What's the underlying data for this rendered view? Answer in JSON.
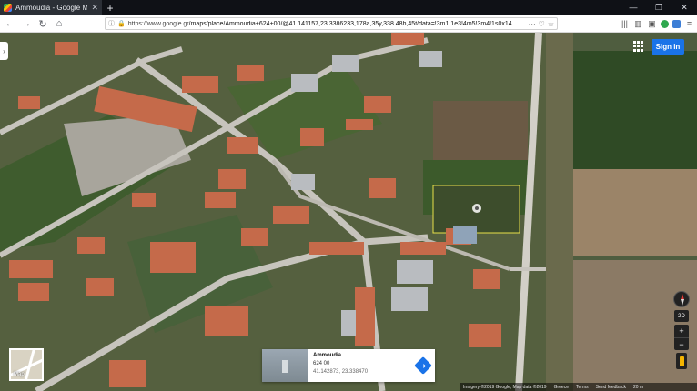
{
  "browser": {
    "tab_title": "Ammoudia - Google Maps",
    "new_tab_label": "+",
    "url_host": "https://www.google.gr",
    "url_path": "/maps/place/Ammoudia+624+00/@41.141157,23.3386233,178a,35y,338.48h,45t/data=!3m1!1e3!4m5!3m4!1s0x14",
    "window_controls": {
      "minimize": "—",
      "maximize": "❐",
      "close": "✕"
    }
  },
  "maps": {
    "signin_label": "Sign in",
    "minimap_label": "Map",
    "place_card": {
      "name": "Ammoudia",
      "postal": "624 00",
      "coords": "41.142873, 23.338470"
    },
    "controls": {
      "view_label": "2D",
      "zoom_in": "+",
      "zoom_out": "−"
    },
    "footer": {
      "imagery": "Imagery ©2019 Google, Map data ©2019",
      "country": "Greece",
      "terms": "Terms",
      "feedback": "Send feedback",
      "scale": "20 m"
    }
  },
  "colors": {
    "tabbar": "#0f1116",
    "signin": "#1a73e8",
    "roof": "#c56a4a",
    "field": "#6b5b45",
    "grass": "#3f5c2e",
    "road": "#bfbfbf"
  }
}
